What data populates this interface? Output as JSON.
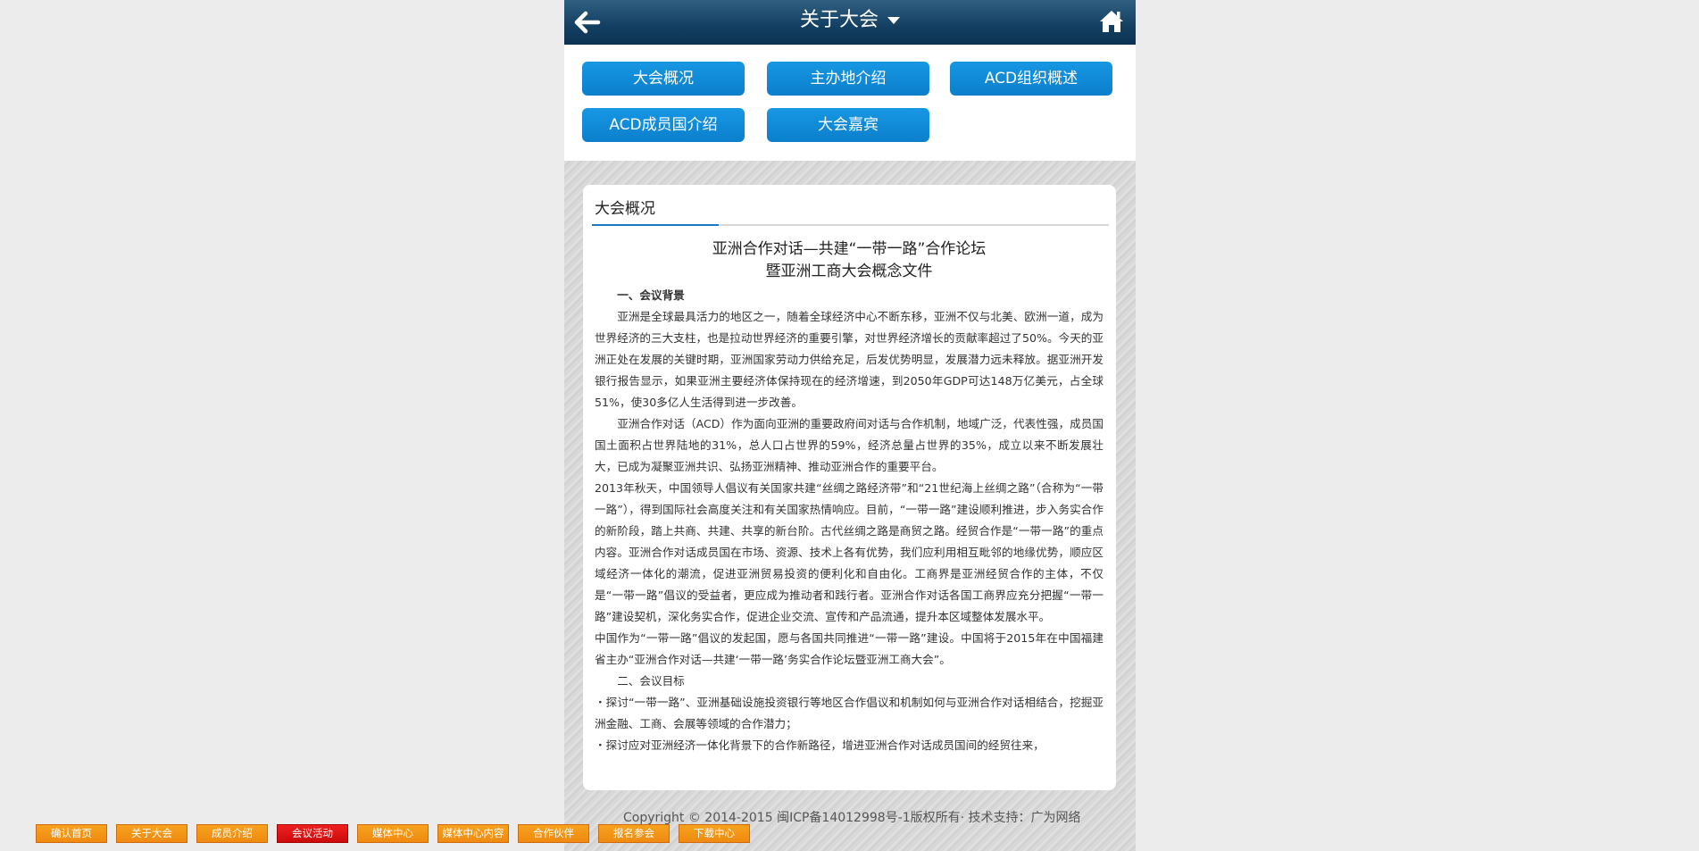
{
  "header": {
    "title": "关于大会"
  },
  "nav": {
    "buttons": [
      "大会概况",
      "主办地介绍",
      "ACD组织概述",
      "ACD成员国介绍",
      "大会嘉宾"
    ]
  },
  "card": {
    "title": "大会概况",
    "doc_title_line1": "亚洲合作对话—共建“一带一路”合作论坛",
    "doc_title_line2": "暨亚洲工商大会概念文件",
    "paragraphs": [
      "一、会议背景",
      "亚洲是全球最具活力的地区之一，随着全球经济中心不断东移，亚洲不仅与北美、欧洲一道，成为世界经济的三大支柱，也是拉动世界经济的重要引擎，对世界经济增长的贡献率超过了50%。今天的亚洲正处在发展的关键时期，亚洲国家劳动力供给充足，后发优势明显，发展潜力远未释放。据亚洲开发银行报告显示，如果亚洲主要经济体保持现在的经济增速，到2050年GDP可达148万亿美元，占全球51%，使30多亿人生活得到进一步改善。",
      "亚洲合作对话（ACD）作为面向亚洲的重要政府间对话与合作机制，地域广泛，代表性强，成员国国土面积占世界陆地的31%，总人口占世界的59%，经济总量占世界的35%，成立以来不断发展壮大，已成为凝聚亚洲共识、弘扬亚洲精神、推动亚洲合作的重要平台。",
      "2013年秋天，中国领导人倡议有关国家共建“丝绸之路经济带”和“21世纪海上丝绸之路”（合称为“一带一路”），得到国际社会高度关注和有关国家热情响应。目前，“一带一路”建设顺利推进，步入务实合作的新阶段，踏上共商、共建、共享的新台阶。古代丝绸之路是商贸之路。经贸合作是“一带一路”的重点内容。亚洲合作对话成员国在市场、资源、技术上各有优势，我们应利用相互毗邻的地缘优势，顺应区域经济一体化的潮流，促进亚洲贸易投资的便利化和自由化。工商界是亚洲经贸合作的主体，不仅是“一带一路”倡议的受益者，更应成为推动者和践行者。亚洲合作对话各国工商界应充分把握“一带一路”建设契机，深化务实合作，促进企业交流、宣传和产品流通，提升本区域整体发展水平。",
      "中国作为“一带一路”倡议的发起国，愿与各国共同推进“一带一路”建设。中国将于2015年在中国福建省主办“亚洲合作对话—共建‘一带一路’务实合作论坛暨亚洲工商大会”。",
      "二、会议目标",
      "・探讨“一带一路”、亚洲基础设施投资银行等地区合作倡议和机制如何与亚洲合作对话相结合，挖掘亚洲金融、工商、会展等领域的合作潜力；",
      "・探讨应对亚洲经济一体化背景下的合作新路径，增进亚洲合作对话成员国间的经贸往来，"
    ]
  },
  "footer": {
    "text": "Copyright © 2014-2015 闽ICP备14012998号-1版权所有·    技术支持：广为网络"
  },
  "bottom_bar": {
    "buttons": [
      "确认首页",
      "关于大会",
      "成员介绍",
      "会议活动",
      "媒体中心",
      "媒体中心内容",
      "合作伙伴",
      "报名参会",
      "下载中心"
    ],
    "active_index": 3
  },
  "colors": {
    "header_bg": "#133f61",
    "nav_button": "#0b7fcc",
    "accent_line": "#1a7ac7",
    "bottom_button": "#ef8a10",
    "bottom_button_active": "#cc0b0b"
  },
  "icons": {
    "back": "arrow-left-icon",
    "home": "home-icon",
    "dropdown": "caret-down-icon"
  }
}
